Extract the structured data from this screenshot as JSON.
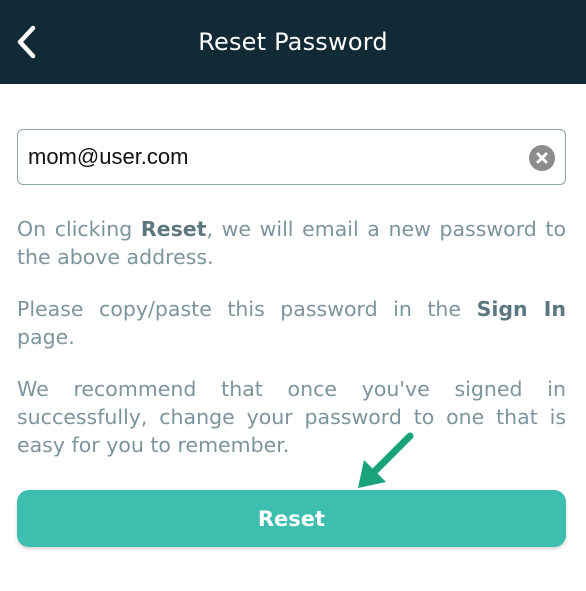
{
  "header": {
    "title": "Reset Password",
    "back_icon": "chevron-left-icon"
  },
  "form": {
    "email_value": "mom@user.com",
    "clear_icon": "close-circle-icon"
  },
  "instructions": {
    "p1": {
      "before": "On clicking ",
      "bold": "Reset",
      "after": ", we will email a new password to the above address."
    },
    "p2": {
      "before": "Please copy/paste this password in the ",
      "bold": "Sign In",
      "after": " page."
    },
    "p3": {
      "text": "We recommend that once you've signed in successfully, change your password to one that is easy for you to remember."
    }
  },
  "reset_button": {
    "label": "Reset"
  },
  "annotation": {
    "arrow_icon": "pointer-arrow-icon",
    "arrow_color": "#1aa37a"
  },
  "colors": {
    "header_bg": "#112a35",
    "button_bg": "#3cbfae",
    "text": "#7b949d"
  }
}
